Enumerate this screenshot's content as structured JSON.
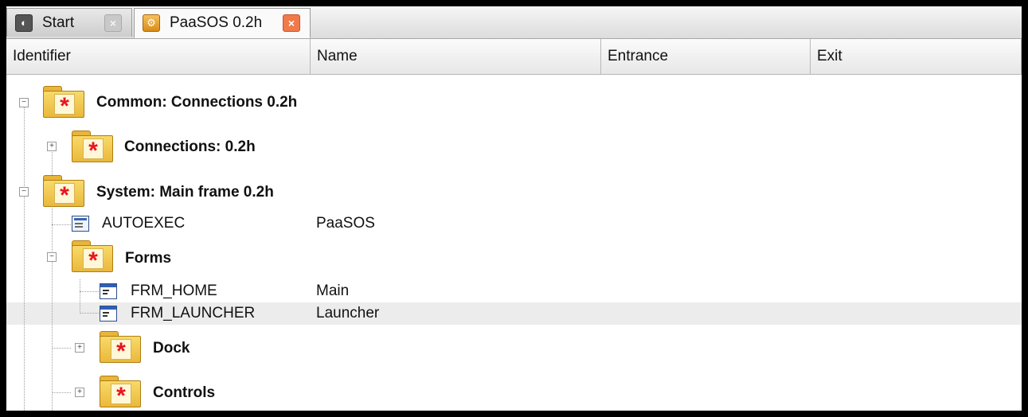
{
  "tabs": [
    {
      "label": "Start",
      "icon": "start-icon",
      "close": "×"
    },
    {
      "label": "PaaSOS 0.2h",
      "icon": "gear-icon",
      "close": "×"
    }
  ],
  "columns": [
    "Identifier",
    "Name",
    "Entrance",
    "Exit"
  ],
  "tree": {
    "common": {
      "label": "Common: Connections 0.2h",
      "expander": "−"
    },
    "connections": {
      "label": "Connections: 0.2h",
      "expander": "+"
    },
    "system": {
      "label": "System: Main frame 0.2h",
      "expander": "−"
    },
    "autoexec": {
      "identifier": "AUTOEXEC",
      "name": "PaaSOS"
    },
    "forms": {
      "label": "Forms",
      "expander": "−"
    },
    "frm_home": {
      "identifier": "FRM_HOME",
      "name": "Main"
    },
    "frm_launcher": {
      "identifier": "FRM_LAUNCHER",
      "name": "Launcher"
    },
    "dock": {
      "label": "Dock",
      "expander": "+"
    },
    "controls": {
      "label": "Controls",
      "expander": "+"
    }
  },
  "colors": {
    "folder": "#f0c64a",
    "star": "#e8141e",
    "selected_row": "#ececec"
  }
}
